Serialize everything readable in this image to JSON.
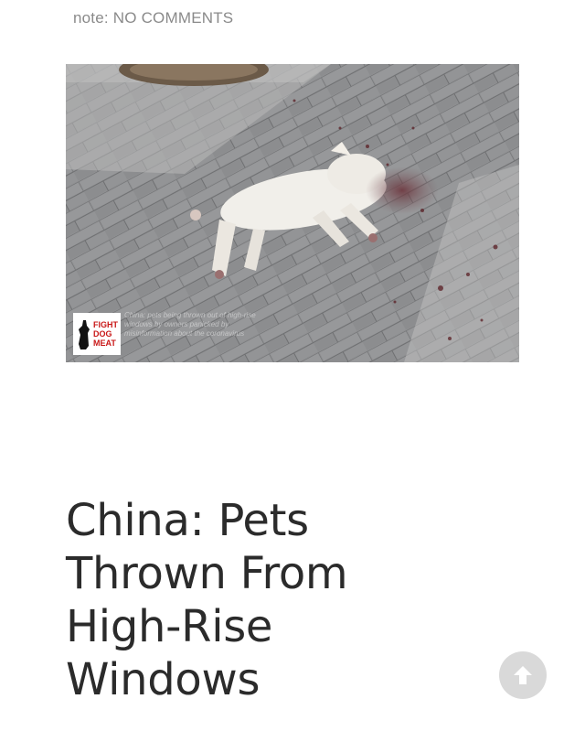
{
  "post": {
    "meta_label": "note:",
    "meta_value": "NO COMMENTS",
    "title": "China: Pets Thrown From High-Rise Windows"
  },
  "image": {
    "subject": "white dog lying on brick pavement",
    "watermark": {
      "brand": "FIGHT DOG MEAT",
      "brand_color": "#c91818",
      "caption": "China: pets being thrown out of high-rise windows by owners panicked by misinformation about the coronavirus"
    }
  },
  "scroll_top": {
    "icon": "arrow-up-icon"
  },
  "colors": {
    "meta_text": "#8a8a8a",
    "title_text": "#2b2b2b",
    "scroll_button": "#d9d9d9"
  }
}
